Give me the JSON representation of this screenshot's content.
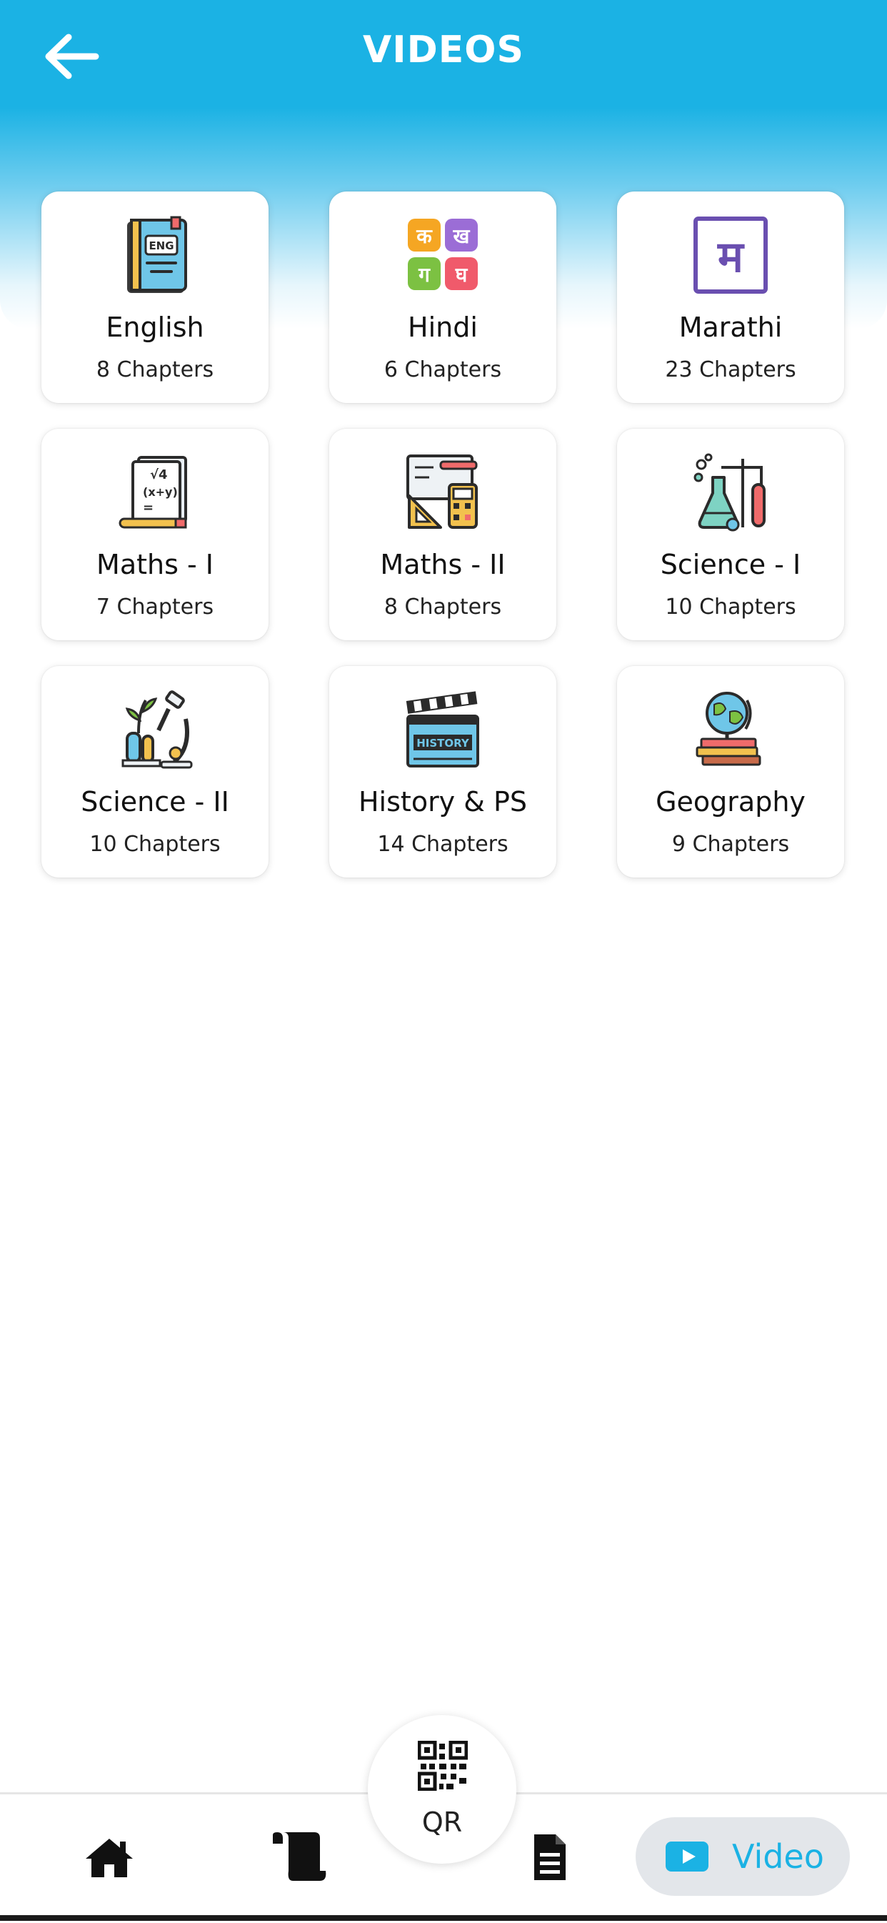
{
  "header": {
    "title": "VIDEOS"
  },
  "subjects": [
    {
      "name": "English",
      "chapters": "8 Chapters",
      "icon": "english-book-icon"
    },
    {
      "name": "Hindi",
      "chapters": "6 Chapters",
      "icon": "hindi-letters-icon"
    },
    {
      "name": "Marathi",
      "chapters": "23 Chapters",
      "icon": "marathi-letter-icon"
    },
    {
      "name": "Maths - I",
      "chapters": "7 Chapters",
      "icon": "maths-formula-icon"
    },
    {
      "name": "Maths - II",
      "chapters": "8 Chapters",
      "icon": "geometry-tools-icon"
    },
    {
      "name": "Science - I",
      "chapters": "10 Chapters",
      "icon": "chemistry-flasks-icon"
    },
    {
      "name": "Science - II",
      "chapters": "10 Chapters",
      "icon": "microscope-plant-icon"
    },
    {
      "name": "History & PS",
      "chapters": "14 Chapters",
      "icon": "history-clapperboard-icon"
    },
    {
      "name": "Geography",
      "chapters": "9 Chapters",
      "icon": "globe-books-icon"
    }
  ],
  "qr_subjects_glyph": "क ख ग घ म",
  "hindi_glyphs": [
    "क",
    "ख",
    "ग",
    "घ"
  ],
  "marathi_glyph": "म",
  "english_tag": "ENG",
  "maths_tag_top": "√4",
  "maths_tag_mid": "(x+y)",
  "maths_tag_bot": "=",
  "history_tag": "HISTORY",
  "bottom_nav": {
    "qr_label": "QR",
    "video_label": "Video"
  },
  "colors": {
    "accent": "#1bb2e4",
    "pill_bg": "#e3e6ea"
  }
}
